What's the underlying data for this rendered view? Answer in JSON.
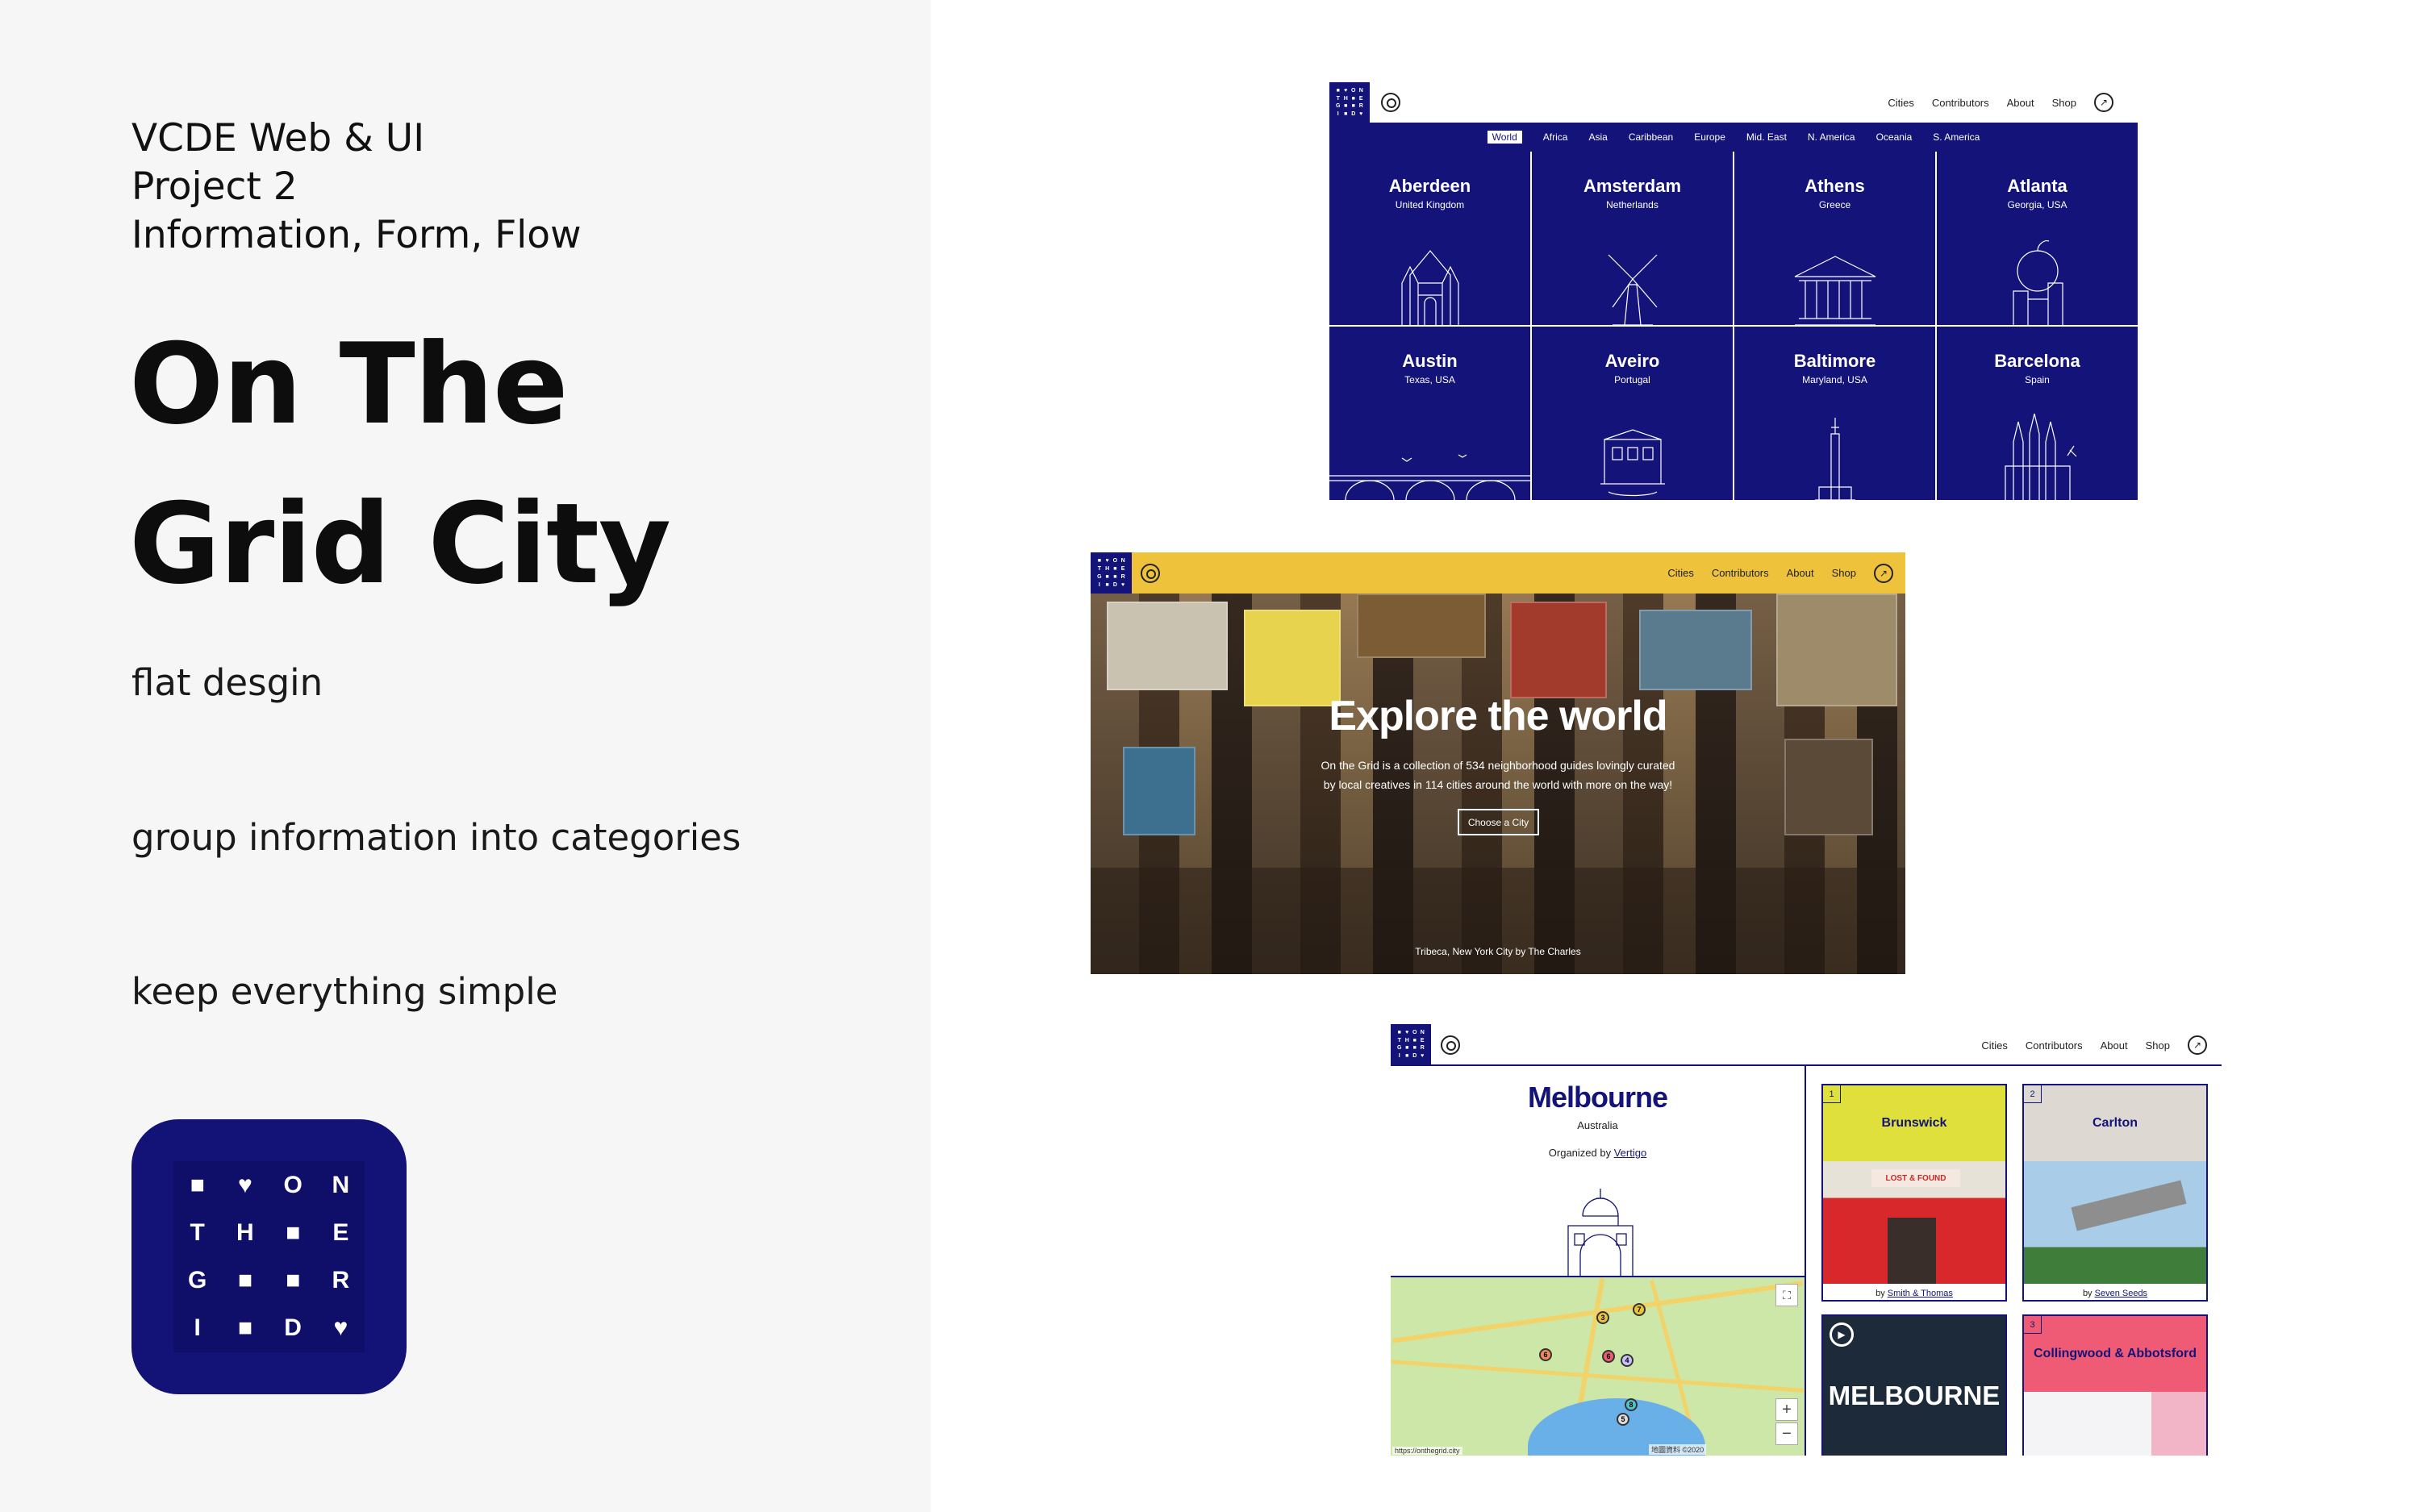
{
  "course": {
    "line1": "VCDE Web & UI",
    "line2": "Project 2",
    "line3": "Information, Form, Flow"
  },
  "title": {
    "line1": "On The",
    "line2": "Grid City"
  },
  "principles": [
    "flat desgin",
    "group information into categories",
    "keep everything simple"
  ],
  "app_icon": {
    "cells": [
      "■",
      "♥",
      "O",
      "N",
      "T",
      "H",
      "■",
      "E",
      "G",
      "■",
      "■",
      "R",
      "I",
      "■",
      "D",
      "♥"
    ]
  },
  "nav": {
    "links": [
      "Cities",
      "Contributors",
      "About",
      "Shop"
    ],
    "search_icon": "search-icon",
    "external_icon": "external-link-icon"
  },
  "screen1": {
    "regions": [
      "World",
      "Africa",
      "Asia",
      "Caribbean",
      "Europe",
      "Mid. East",
      "N. America",
      "Oceania",
      "S. America"
    ],
    "active_region": "World",
    "cities": [
      {
        "name": "Aberdeen",
        "country": "United Kingdom"
      },
      {
        "name": "Amsterdam",
        "country": "Netherlands"
      },
      {
        "name": "Athens",
        "country": "Greece"
      },
      {
        "name": "Atlanta",
        "country": "Georgia, USA"
      },
      {
        "name": "Austin",
        "country": "Texas, USA"
      },
      {
        "name": "Aveiro",
        "country": "Portugal"
      },
      {
        "name": "Baltimore",
        "country": "Maryland, USA"
      },
      {
        "name": "Barcelona",
        "country": "Spain"
      }
    ],
    "brand_color": "#13137a"
  },
  "screen2": {
    "headline": "Explore the world",
    "sub_line1": "On the Grid is a collection of 534 neighborhood guides lovingly curated",
    "sub_line2": "by local creatives in 114 cities around the world with more on the way!",
    "cta": "Choose a City",
    "photo_credit": "Tribeca, New York City by The Charles",
    "nav_color": "#efc23b"
  },
  "screen3": {
    "city": "Melbourne",
    "country": "Australia",
    "organized_prefix": "Organized by ",
    "organizer": "Vertigo",
    "map_url": "https://onthegrid.city",
    "map_copyright": "地圖資料 ©2020",
    "pins": [
      "3",
      "7",
      "6",
      "6",
      "4",
      "8",
      "5"
    ],
    "neighborhoods": [
      {
        "num": "1",
        "name": "Brunswick",
        "by_prefix": "by ",
        "by": "Smith & Thomas",
        "color": "#dfe03b"
      },
      {
        "num": "2",
        "name": "Carlton",
        "by_prefix": "by ",
        "by": "Seven Seeds",
        "color": "#ddd8d2"
      },
      {
        "num": "3",
        "name": "Collingwood & Abbotsford",
        "color": "#ef5b74"
      }
    ],
    "video_label": "MELBOURNE",
    "brunswick_sign": "LOST & FOUND"
  }
}
